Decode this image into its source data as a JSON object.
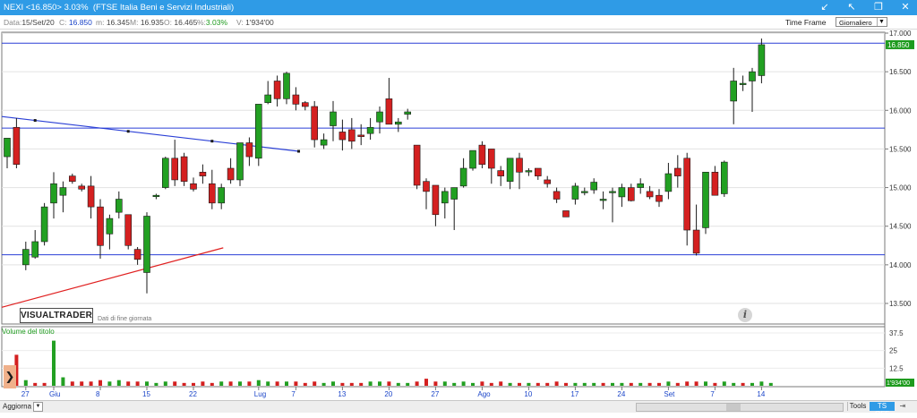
{
  "window": {
    "title": "NEXI <16.850> 3.03%  (FTSE Italia Beni e Servizi Industriali)",
    "controls": [
      "arrow-icon",
      "pin-icon",
      "restore-icon",
      "close-icon"
    ]
  },
  "info": {
    "date_label": "Data:",
    "date_value": "15/Set/20",
    "close_label": "C:",
    "close_value": "16.850",
    "min_label": "m:",
    "min_value": "16.345",
    "max_label": "M:",
    "max_value": "16.935",
    "open_label": "O:",
    "open_value": "16.465",
    "pct_label": "%:",
    "pct_value": "3.03%",
    "vol_label": "V:",
    "vol_value": "1'934'00"
  },
  "timeframe": {
    "label": "Time Frame",
    "value": "Giornaliero"
  },
  "logo": {
    "name": "VISUALTRADER",
    "sub": "Dati di fine giornata"
  },
  "volume": {
    "label": "Volume del titolo"
  },
  "status": {
    "refresh_label": "Aggiorna",
    "tools_label": "Tools",
    "tsoff_label": "TS OFF"
  },
  "colors": {
    "up": "#22a022",
    "down": "#d42020",
    "accent": "#2f9be6",
    "trendline": "#2a3fd6",
    "support": "#e02020"
  },
  "chart_data": {
    "type": "candlestick",
    "price_axis": {
      "ticks": [
        "17.000",
        "16.500",
        "16.000",
        "15.500",
        "15.000",
        "14.500",
        "14.000",
        "13.500"
      ],
      "min": 13.5,
      "max": 17.0
    },
    "last_price_label": "16.850",
    "volume_axis": {
      "ticks": [
        "37.5",
        "25",
        "12.5"
      ],
      "last_label": "1'934'00"
    },
    "date_ticks": [
      "27",
      "Giu",
      "8",
      "15",
      "22",
      "Lug",
      "7",
      "13",
      "20",
      "27",
      "Ago",
      "10",
      "17",
      "24",
      "Set",
      "7",
      "14"
    ],
    "horizontal_lines": [
      16.87,
      15.77,
      14.13
    ],
    "trendlines": [
      {
        "name": "downtrend",
        "color": "blue",
        "from": [
          "2020-05-25",
          15.92
        ],
        "to": [
          "2020-07-06",
          15.47
        ]
      },
      {
        "name": "uptrend",
        "color": "red",
        "from": [
          "2020-05-22",
          13.45
        ],
        "to": [
          "2020-06-25",
          14.22
        ]
      }
    ],
    "candles": [
      {
        "o": 15.4,
        "h": 15.53,
        "l": 15.25,
        "c": 15.64
      },
      {
        "o": 15.78,
        "h": 15.9,
        "l": 15.25,
        "c": 15.3
      },
      {
        "o": 14.0,
        "h": 14.3,
        "l": 13.93,
        "c": 14.2
      },
      {
        "o": 14.1,
        "h": 14.45,
        "l": 14.08,
        "c": 14.3
      },
      {
        "o": 14.3,
        "h": 14.8,
        "l": 14.25,
        "c": 14.75
      },
      {
        "o": 14.8,
        "h": 15.2,
        "l": 14.6,
        "c": 15.05
      },
      {
        "o": 14.9,
        "h": 15.08,
        "l": 14.68,
        "c": 15.0
      },
      {
        "o": 15.15,
        "h": 15.18,
        "l": 15.05,
        "c": 15.08
      },
      {
        "o": 15.02,
        "h": 15.05,
        "l": 14.95,
        "c": 14.98
      },
      {
        "o": 15.02,
        "h": 15.15,
        "l": 14.6,
        "c": 14.75
      },
      {
        "o": 14.75,
        "h": 14.85,
        "l": 14.08,
        "c": 14.25
      },
      {
        "o": 14.4,
        "h": 14.65,
        "l": 14.2,
        "c": 14.6
      },
      {
        "o": 14.68,
        "h": 14.95,
        "l": 14.6,
        "c": 14.85
      },
      {
        "o": 14.65,
        "h": 14.65,
        "l": 14.2,
        "c": 14.25
      },
      {
        "o": 14.2,
        "h": 14.23,
        "l": 14.0,
        "c": 14.07
      },
      {
        "o": 13.9,
        "h": 14.68,
        "l": 13.63,
        "c": 14.63
      },
      {
        "o": 14.9,
        "h": 14.92,
        "l": 14.85,
        "c": 14.9
      },
      {
        "o": 15.0,
        "h": 15.4,
        "l": 14.98,
        "c": 15.38
      },
      {
        "o": 15.38,
        "h": 15.62,
        "l": 15.02,
        "c": 15.1
      },
      {
        "o": 15.4,
        "h": 15.45,
        "l": 15.02,
        "c": 15.08
      },
      {
        "o": 15.05,
        "h": 15.13,
        "l": 14.95,
        "c": 14.98
      },
      {
        "o": 15.2,
        "h": 15.3,
        "l": 15.05,
        "c": 15.15
      },
      {
        "o": 15.05,
        "h": 15.23,
        "l": 14.72,
        "c": 14.8
      },
      {
        "o": 14.8,
        "h": 15.05,
        "l": 14.72,
        "c": 15.0
      },
      {
        "o": 15.25,
        "h": 15.38,
        "l": 15.05,
        "c": 15.1
      },
      {
        "o": 15.1,
        "h": 15.42,
        "l": 15.02,
        "c": 15.58
      },
      {
        "o": 15.58,
        "h": 15.65,
        "l": 15.28,
        "c": 15.4
      },
      {
        "o": 15.38,
        "h": 16.08,
        "l": 15.28,
        "c": 16.08
      },
      {
        "o": 16.1,
        "h": 16.38,
        "l": 16.08,
        "c": 16.2
      },
      {
        "o": 16.38,
        "h": 16.45,
        "l": 16.05,
        "c": 16.15
      },
      {
        "o": 16.15,
        "h": 16.5,
        "l": 16.08,
        "c": 16.48
      },
      {
        "o": 16.2,
        "h": 16.3,
        "l": 16.0,
        "c": 16.08
      },
      {
        "o": 16.1,
        "h": 16.12,
        "l": 16.0,
        "c": 16.05
      },
      {
        "o": 16.05,
        "h": 16.12,
        "l": 15.52,
        "c": 15.62
      },
      {
        "o": 15.55,
        "h": 15.7,
        "l": 15.5,
        "c": 15.62
      },
      {
        "o": 15.8,
        "h": 16.12,
        "l": 15.6,
        "c": 15.98
      },
      {
        "o": 15.72,
        "h": 15.88,
        "l": 15.48,
        "c": 15.62
      },
      {
        "o": 15.75,
        "h": 15.9,
        "l": 15.5,
        "c": 15.6
      },
      {
        "o": 15.68,
        "h": 15.82,
        "l": 15.55,
        "c": 15.66
      },
      {
        "o": 15.7,
        "h": 15.9,
        "l": 15.62,
        "c": 15.78
      },
      {
        "o": 15.85,
        "h": 16.05,
        "l": 15.7,
        "c": 15.98
      },
      {
        "o": 16.15,
        "h": 16.42,
        "l": 15.98,
        "c": 15.82
      },
      {
        "o": 15.82,
        "h": 15.9,
        "l": 15.72,
        "c": 15.85
      },
      {
        "o": 15.95,
        "h": 16.02,
        "l": 15.88,
        "c": 15.98
      },
      {
        "o": 15.55,
        "h": 15.55,
        "l": 14.98,
        "c": 15.03
      },
      {
        "o": 15.08,
        "h": 15.12,
        "l": 14.72,
        "c": 14.95
      },
      {
        "o": 15.03,
        "h": 15.03,
        "l": 14.5,
        "c": 14.65
      },
      {
        "o": 14.8,
        "h": 15.0,
        "l": 14.6,
        "c": 14.95
      },
      {
        "o": 14.85,
        "h": 15.0,
        "l": 14.45,
        "c": 15.0
      },
      {
        "o": 15.02,
        "h": 15.38,
        "l": 15.0,
        "c": 15.25
      },
      {
        "o": 15.25,
        "h": 15.48,
        "l": 15.22,
        "c": 15.48
      },
      {
        "o": 15.55,
        "h": 15.6,
        "l": 15.25,
        "c": 15.3
      },
      {
        "o": 15.5,
        "h": 15.5,
        "l": 15.05,
        "c": 15.25
      },
      {
        "o": 15.22,
        "h": 15.28,
        "l": 15.02,
        "c": 15.15
      },
      {
        "o": 15.08,
        "h": 15.38,
        "l": 14.98,
        "c": 15.38
      },
      {
        "o": 15.38,
        "h": 15.45,
        "l": 14.98,
        "c": 15.2
      },
      {
        "o": 15.22,
        "h": 15.25,
        "l": 15.15,
        "c": 15.22
      },
      {
        "o": 15.25,
        "h": 15.25,
        "l": 15.1,
        "c": 15.15
      },
      {
        "o": 15.1,
        "h": 15.15,
        "l": 15.0,
        "c": 15.05
      },
      {
        "o": 14.95,
        "h": 15.0,
        "l": 14.8,
        "c": 14.85
      },
      {
        "o": 14.7,
        "h": 14.7,
        "l": 14.62,
        "c": 14.62
      },
      {
        "o": 14.85,
        "h": 15.06,
        "l": 14.78,
        "c": 15.02
      },
      {
        "o": 14.95,
        "h": 15.0,
        "l": 14.9,
        "c": 14.95
      },
      {
        "o": 14.97,
        "h": 15.12,
        "l": 14.92,
        "c": 15.07
      },
      {
        "o": 14.85,
        "h": 14.95,
        "l": 14.72,
        "c": 14.85
      },
      {
        "o": 14.95,
        "h": 15.0,
        "l": 14.55,
        "c": 14.95
      },
      {
        "o": 14.88,
        "h": 15.05,
        "l": 14.75,
        "c": 15.0
      },
      {
        "o": 15.0,
        "h": 15.05,
        "l": 14.82,
        "c": 14.83
      },
      {
        "o": 15.0,
        "h": 15.12,
        "l": 14.92,
        "c": 15.05
      },
      {
        "o": 14.95,
        "h": 15.02,
        "l": 14.85,
        "c": 14.88
      },
      {
        "o": 14.9,
        "h": 14.98,
        "l": 14.75,
        "c": 14.82
      },
      {
        "o": 14.95,
        "h": 15.32,
        "l": 14.85,
        "c": 15.18
      },
      {
        "o": 15.25,
        "h": 15.42,
        "l": 15.0,
        "c": 15.15
      },
      {
        "o": 15.38,
        "h": 15.45,
        "l": 14.25,
        "c": 14.45
      },
      {
        "o": 14.45,
        "h": 14.78,
        "l": 14.12,
        "c": 14.15
      },
      {
        "o": 14.48,
        "h": 15.2,
        "l": 14.4,
        "c": 15.2
      },
      {
        "o": 15.2,
        "h": 15.28,
        "l": 14.95,
        "c": 14.9
      },
      {
        "o": 14.92,
        "h": 15.35,
        "l": 14.88,
        "c": 15.33
      },
      {
        "o": 16.12,
        "h": 16.55,
        "l": 15.82,
        "c": 16.38
      },
      {
        "o": 16.35,
        "h": 16.45,
        "l": 16.25,
        "c": 16.35
      },
      {
        "o": 16.38,
        "h": 16.55,
        "l": 15.98,
        "c": 16.5
      },
      {
        "o": 16.45,
        "h": 16.93,
        "l": 16.35,
        "c": 16.85
      }
    ],
    "volumes": [
      11,
      22,
      4,
      2,
      2,
      32,
      6,
      3,
      3,
      3,
      4,
      3,
      4,
      3,
      3,
      3,
      2,
      3,
      3,
      2,
      2,
      3,
      2,
      3,
      3,
      3,
      3,
      4,
      3,
      3,
      3,
      3,
      2,
      3,
      2,
      3,
      2,
      2,
      2,
      3,
      3,
      3,
      2,
      2,
      3,
      5,
      3,
      3,
      2,
      3,
      2,
      3,
      2,
      3,
      2,
      2,
      2,
      2,
      2,
      3,
      2,
      2,
      2,
      2,
      2,
      2,
      2,
      2,
      2,
      2,
      2,
      3,
      2,
      3,
      3,
      3,
      2,
      3,
      2,
      2,
      2,
      3,
      2
    ],
    "volume_colors": [
      1,
      -1,
      1,
      -1,
      -1,
      1,
      1,
      -1,
      -1,
      -1,
      -1,
      1,
      1,
      -1,
      -1,
      1,
      1,
      1,
      -1,
      -1,
      -1,
      -1,
      -1,
      1,
      -1,
      1,
      -1,
      1,
      1,
      -1,
      1,
      -1,
      -1,
      -1,
      1,
      1,
      -1,
      -1,
      -1,
      1,
      1,
      -1,
      1,
      1,
      -1,
      -1,
      -1,
      1,
      1,
      1,
      1,
      -1,
      -1,
      -1,
      1,
      -1,
      1,
      -1,
      -1,
      -1,
      -1,
      1,
      1,
      1,
      -1,
      1,
      1,
      -1,
      1,
      -1,
      -1,
      1,
      -1,
      -1,
      -1,
      1,
      -1,
      1,
      1,
      -1,
      1,
      1,
      1
    ]
  }
}
